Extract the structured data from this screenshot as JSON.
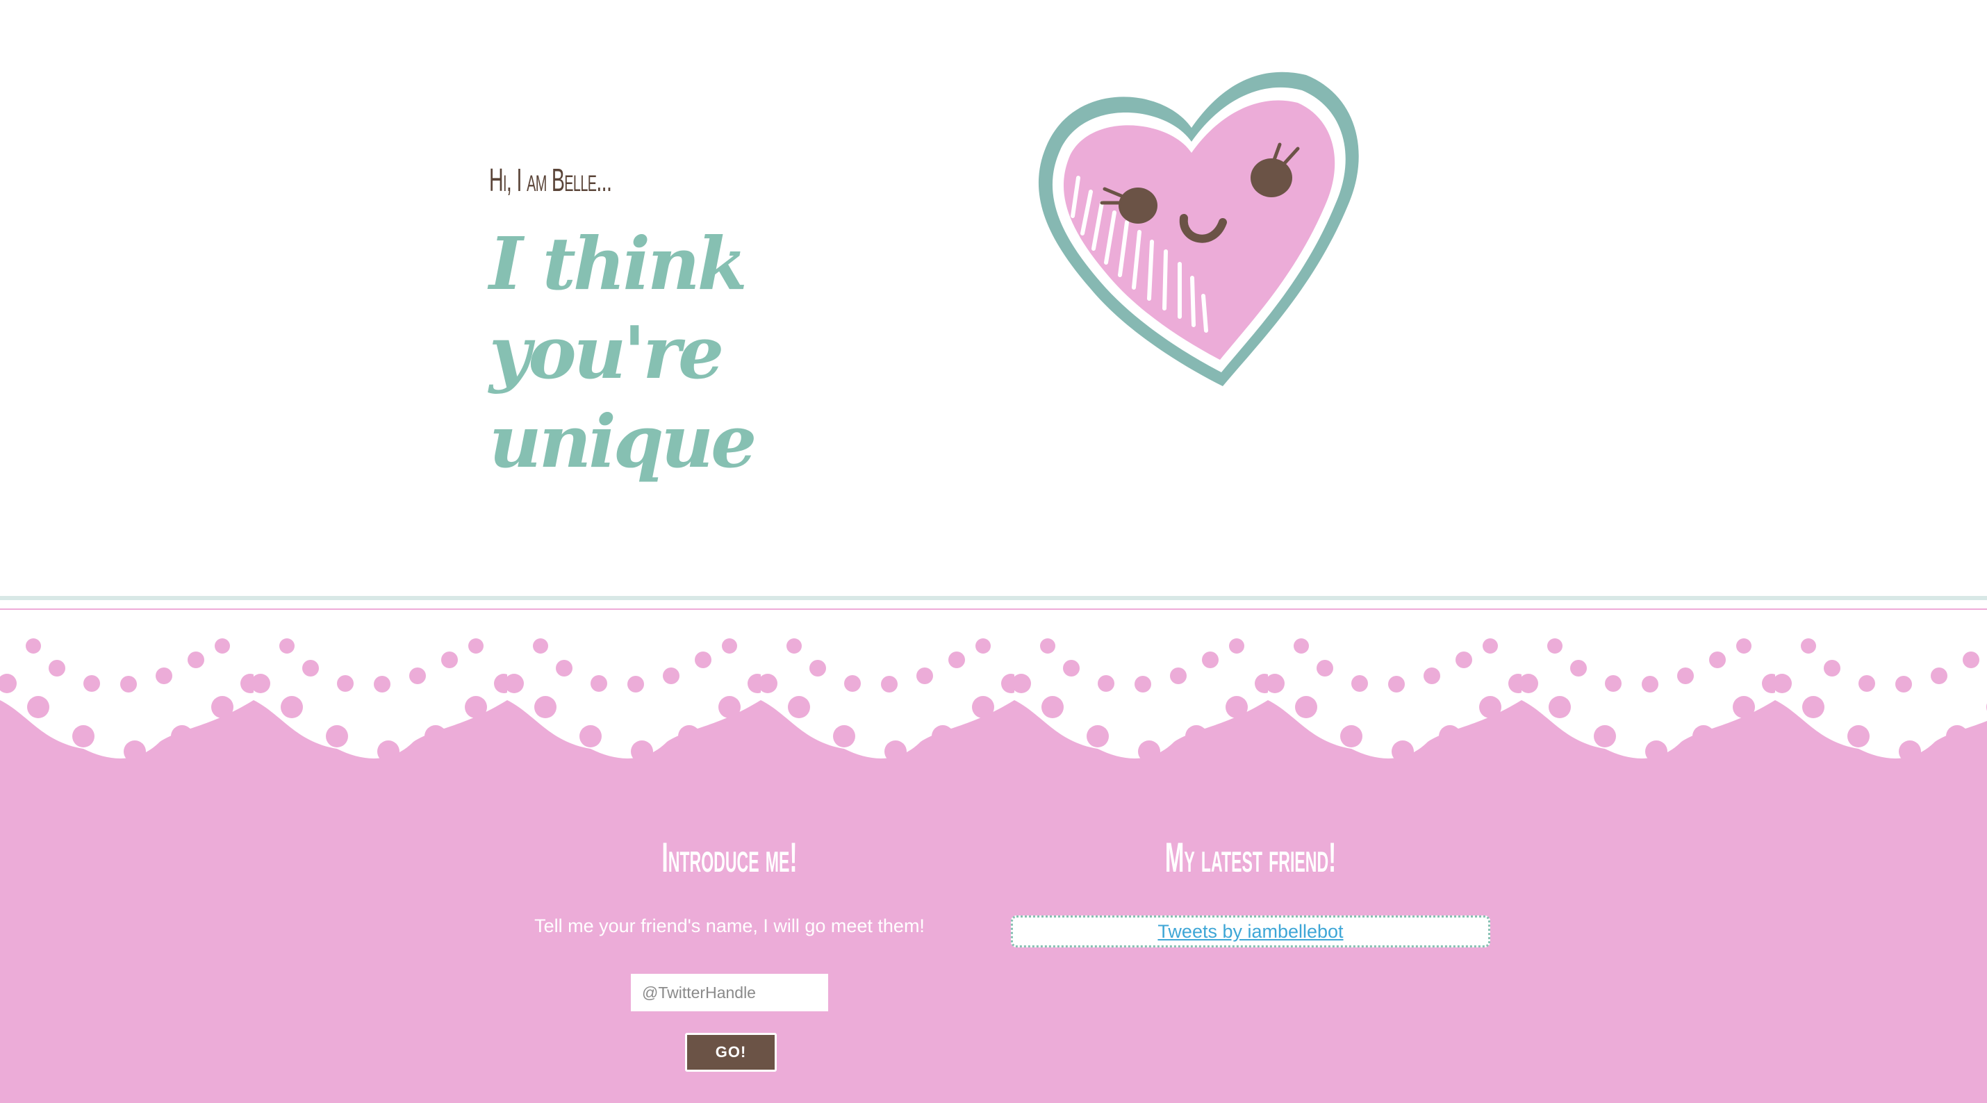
{
  "hero": {
    "greeting": "Hi, I am Belle...",
    "tagline": "I think you're unique"
  },
  "intro": {
    "title": "Introduce me!",
    "text": "Tell me your friend's name, I will go meet them!",
    "input_placeholder": "@TwitterHandle",
    "button_label": "GO!"
  },
  "friend": {
    "title": "My latest friend!",
    "tweets_link": "Tweets by iambellebot"
  },
  "colors": {
    "pink": "#ecacd8",
    "teal": "#86c0b2",
    "brown": "#6b5346",
    "link": "#3ea6d6"
  }
}
